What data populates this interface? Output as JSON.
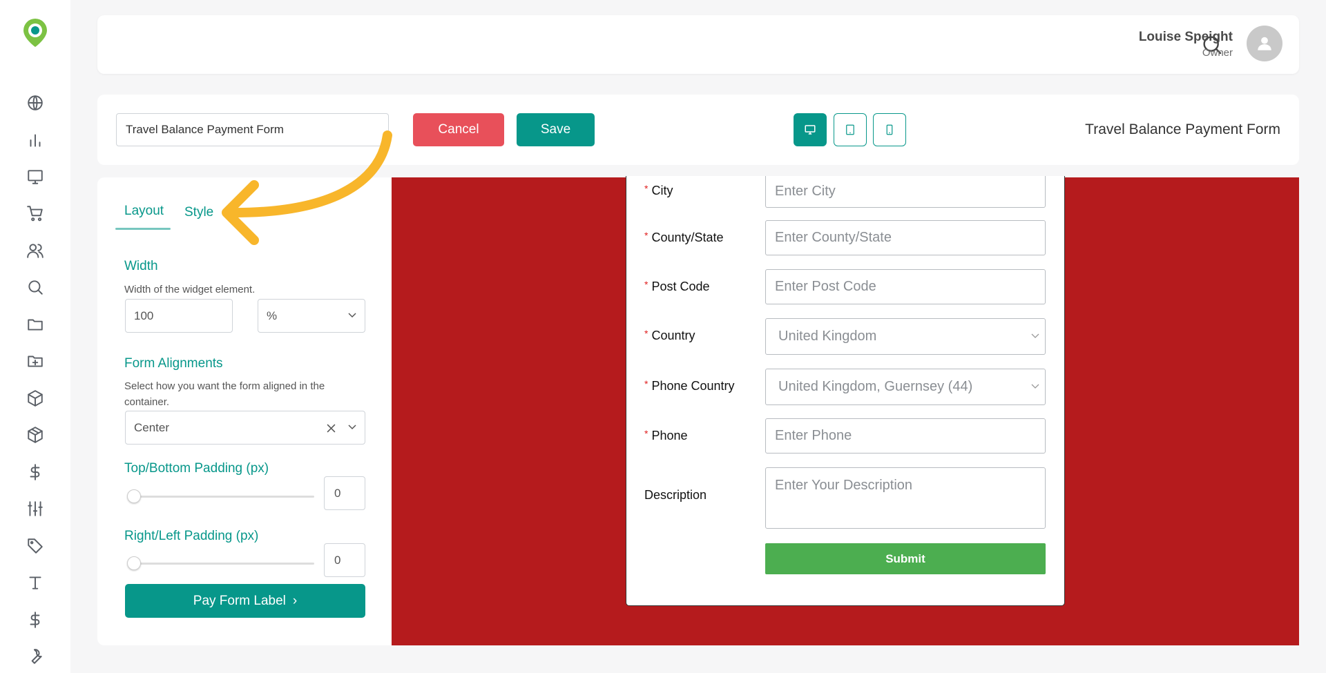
{
  "header": {
    "user_name": "Louise Speight",
    "user_role": "Owner"
  },
  "toolbar": {
    "form_name_value": "Travel Balance Payment Form",
    "cancel_label": "Cancel",
    "save_label": "Save",
    "form_title": "Travel Balance Payment Form"
  },
  "panel": {
    "tabs": [
      {
        "label": "Layout",
        "active": true
      },
      {
        "label": "Style",
        "active": false
      }
    ],
    "width": {
      "title": "Width",
      "description": "Width of the widget element.",
      "value": "100",
      "unit": "%"
    },
    "alignment": {
      "title": "Form Alignments",
      "description": "Select how you want the form aligned in the container.",
      "value": "Center"
    },
    "tb_padding": {
      "title": "Top/Bottom Padding (px)",
      "value": "0"
    },
    "rl_padding": {
      "title": "Right/Left Padding (px)",
      "value": "0"
    },
    "next_button_label": "Pay Form Label",
    "next_button_glyph": "›"
  },
  "form": {
    "fields": [
      {
        "label": "City",
        "required": "*",
        "placeholder": "Enter City"
      },
      {
        "label": "County/State",
        "required": "*",
        "placeholder": "Enter County/State"
      },
      {
        "label": "Post Code",
        "required": "*",
        "placeholder": "Enter Post Code"
      },
      {
        "label": "Country",
        "required": "*",
        "value": "United Kingdom"
      },
      {
        "label": "Phone Country",
        "required": "*",
        "value": "United Kingdom, Guernsey (44)"
      },
      {
        "label": "Phone",
        "required": "*",
        "placeholder": "Enter Phone"
      },
      {
        "label": "Description",
        "placeholder": "Enter Your Description"
      }
    ],
    "submit_label": "Submit"
  },
  "colors": {
    "accent": "#07978a",
    "cancel": "#e8505a",
    "canvas_bg": "#b51b1d",
    "submit": "#4cae50",
    "annotation_arrow": "#f8b62b"
  },
  "icons": {
    "sidebar": [
      "globe-icon",
      "chart-icon",
      "monitor-icon",
      "cart-icon",
      "users-icon",
      "search-icon",
      "folder-icon",
      "folder-plus-icon",
      "box-icon",
      "boxes-icon",
      "dollar-icon",
      "sliders-icon",
      "tag-icon",
      "text-icon",
      "dollar-icon",
      "wrench-icon"
    ]
  }
}
